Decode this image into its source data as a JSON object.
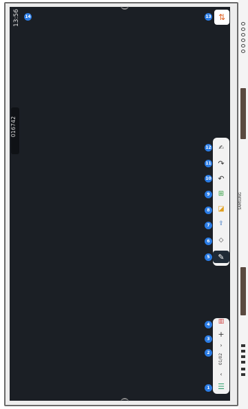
{
  "status": {
    "time": "13:56"
  },
  "session": {
    "code": "016742"
  },
  "pages": {
    "indicator": "01/02"
  },
  "device": {
    "brand": "SAMSUNG"
  },
  "badges": [
    "1",
    "2",
    "3",
    "4",
    "5",
    "6",
    "7",
    "8",
    "9",
    "10",
    "11",
    "12",
    "13",
    "14"
  ],
  "colors": {
    "badge": "#2a7be4",
    "screen": "#1b1f25",
    "toolbar": "#f2f2f2"
  },
  "icons": {
    "menu": "menu-icon",
    "prev": "chevron-left-icon",
    "next": "chevron-right-icon",
    "add": "plus-icon",
    "layout": "grid-icon",
    "pen": "pen-icon",
    "eraser": "eraser-icon",
    "export": "export-icon",
    "sticky": "sticky-note-icon",
    "insert": "insert-image-icon",
    "undo": "undo-icon",
    "redo": "redo-icon",
    "select": "select-icon",
    "swap": "swap-icon"
  }
}
